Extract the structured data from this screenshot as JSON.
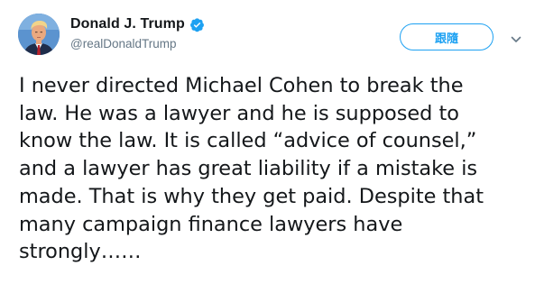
{
  "author": {
    "display_name": "Donald J. Trump",
    "handle": "@realDonaldTrump",
    "verified": true,
    "avatar_icon": "profile-photo"
  },
  "actions": {
    "follow_label": "跟隨",
    "menu_icon": "chevron-down-icon"
  },
  "tweet": {
    "text": "I never directed Michael Cohen to break the\nlaw. He was a lawyer and he is supposed to\nknow the law. It is called “advice of counsel,”\nand a lawyer has great liability if a mistake is\nmade. That is why they get paid. Despite that\nmany campaign finance lawyers have\nstrongly……"
  },
  "colors": {
    "accent": "#1da1f2",
    "text": "#14171a",
    "secondary": "#657786"
  }
}
